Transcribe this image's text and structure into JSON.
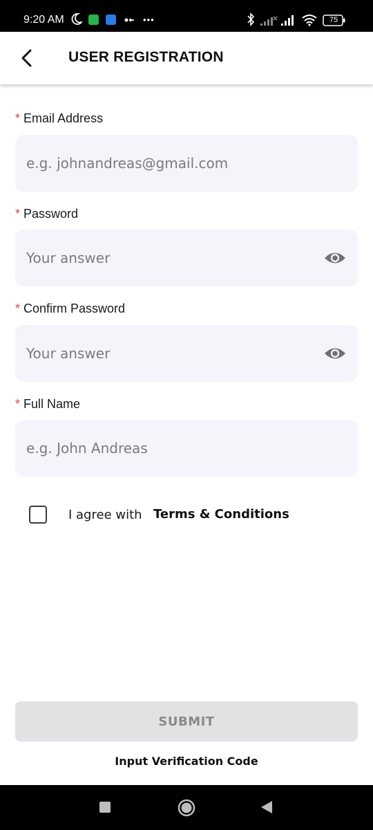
{
  "status_bar": {
    "time": "9:20 AM",
    "battery": "75",
    "icons": [
      "moon-icon",
      "whatsapp-icon",
      "app-icon",
      "dot-icon",
      "more-icon",
      "bluetooth-icon",
      "signal-icon",
      "signal-icon",
      "wifi-icon",
      "battery-icon"
    ]
  },
  "header": {
    "title": "USER REGISTRATION",
    "back_icon": "chevron-left-icon"
  },
  "form": {
    "required_mark": "*",
    "email": {
      "label": "Email Address",
      "placeholder": "e.g. johnandreas@gmail.com"
    },
    "password": {
      "label": "Password",
      "placeholder": "Your answer"
    },
    "confirm_password": {
      "label": "Confirm Password",
      "placeholder": "Your answer"
    },
    "full_name": {
      "label": "Full Name",
      "placeholder": "e.g. John Andreas"
    }
  },
  "terms": {
    "agree_text": "I agree with",
    "link_text": "Terms & Conditions",
    "checked": false
  },
  "actions": {
    "submit_label": "SUBMIT",
    "verify_link": "Input Verification Code"
  },
  "colors": {
    "required": "#d9453b",
    "input_bg": "#f4f4fa",
    "submit_disabled_bg": "#e2e2e4",
    "submit_disabled_text": "#8a8a8c"
  }
}
